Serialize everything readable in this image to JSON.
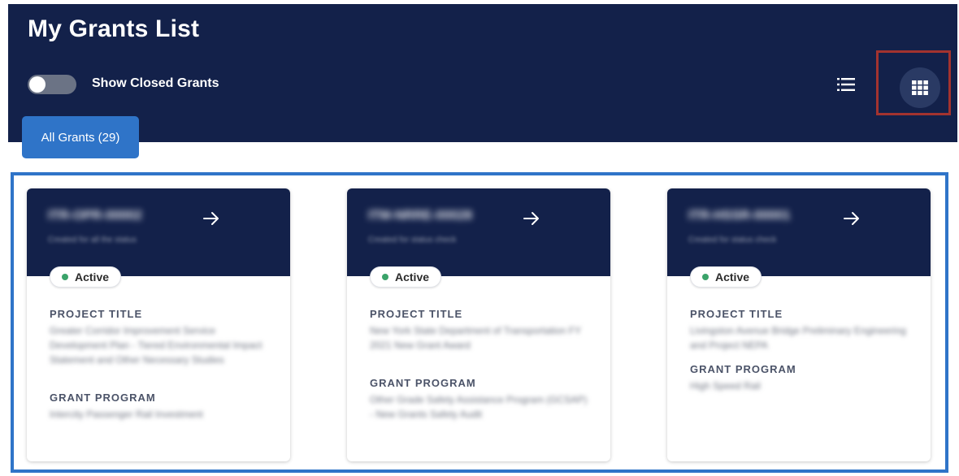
{
  "header": {
    "title": "My Grants List",
    "toggle_label": "Show Closed Grants",
    "toggle_on": false
  },
  "view_icons": {
    "list": "list-view-icon",
    "grid": "grid-view-icon",
    "grid_selected": true
  },
  "tabs": [
    {
      "label": "All Grants (29)"
    }
  ],
  "cards": [
    {
      "id": "ITR-OPR-00002",
      "subtitle": "Created for all the status",
      "status": "Active",
      "project_label": "PROJECT TITLE",
      "project_title": "Greater Corridor Improvement Service Development Plan - Tiered Environmental Impact Statement and Other Necessary Studies",
      "program_label": "GRANT PROGRAM",
      "program": "Intercity Passenger Rail Investment"
    },
    {
      "id": "ITM-NRRE-00028",
      "subtitle": "Created for status check",
      "status": "Active",
      "project_label": "PROJECT TITLE",
      "project_title": "New York State Department of Transportation FY 2021 New Grant Award",
      "program_label": "GRANT PROGRAM",
      "program": "Other Grade Safety Assistance Program (GCSAP) - New Grants Safety Audit"
    },
    {
      "id": "ITR-HSSR-00001",
      "subtitle": "Created for status check",
      "status": "Active",
      "project_label": "PROJECT TITLE",
      "project_title": "Livingston Avenue Bridge Preliminary Engineering and Project NEPA",
      "program_label": "GRANT PROGRAM",
      "program": "High Speed Rail"
    }
  ],
  "colors": {
    "navy": "#13214a",
    "accent_blue": "#2f74c8",
    "highlight_red": "#a3332f",
    "status_green": "#3aa36a"
  }
}
